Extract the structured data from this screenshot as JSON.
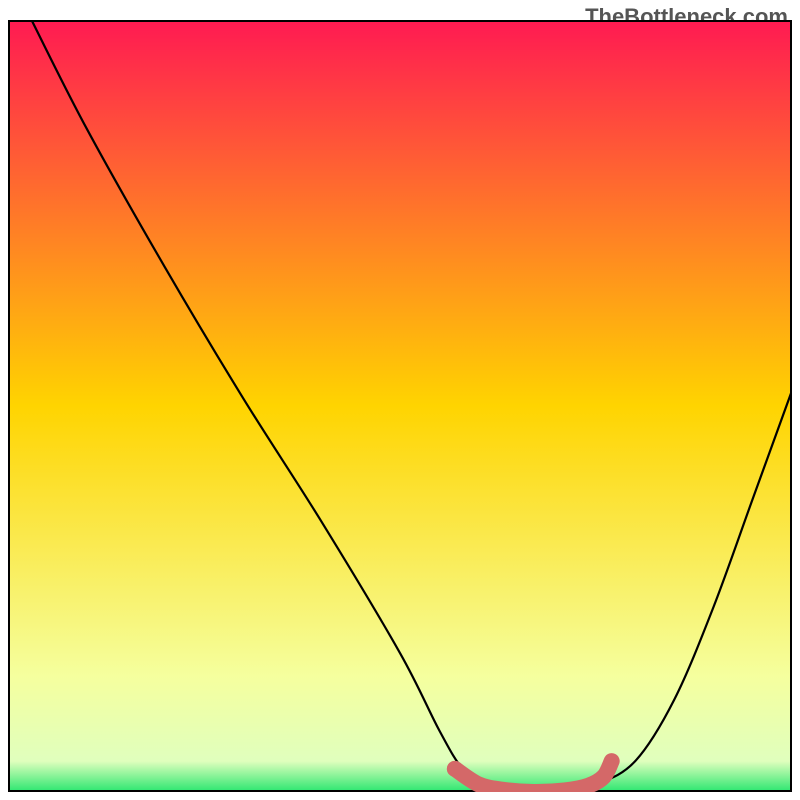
{
  "watermark": "TheBottleneck.com",
  "chart_data": {
    "type": "line",
    "title": "",
    "xlabel": "",
    "ylabel": "",
    "xlim": [
      0,
      100
    ],
    "ylim": [
      0,
      100
    ],
    "background_gradient": {
      "stops": [
        {
          "offset": 0,
          "color": "#ff1a52"
        },
        {
          "offset": 50,
          "color": "#ffd400"
        },
        {
          "offset": 85,
          "color": "#f5ff9e"
        },
        {
          "offset": 96,
          "color": "#e0ffbd"
        },
        {
          "offset": 100,
          "color": "#29e66f"
        }
      ]
    },
    "series": [
      {
        "name": "bottleneck-curve",
        "color": "#000000",
        "x": [
          3,
          10,
          20,
          30,
          40,
          50,
          55,
          58,
          61,
          65,
          70,
          75,
          80,
          85,
          90,
          95,
          100
        ],
        "y": [
          100,
          86,
          68,
          51,
          35,
          18,
          8,
          3,
          1,
          0,
          0,
          1,
          4,
          12,
          24,
          38,
          52
        ]
      }
    ],
    "highlight_zone": {
      "name": "optimal-zone",
      "color": "#d46868",
      "x": [
        57,
        60,
        63,
        67,
        71,
        74,
        76,
        77
      ],
      "y": [
        3,
        1,
        0.3,
        0,
        0.2,
        0.8,
        2,
        4
      ]
    }
  }
}
